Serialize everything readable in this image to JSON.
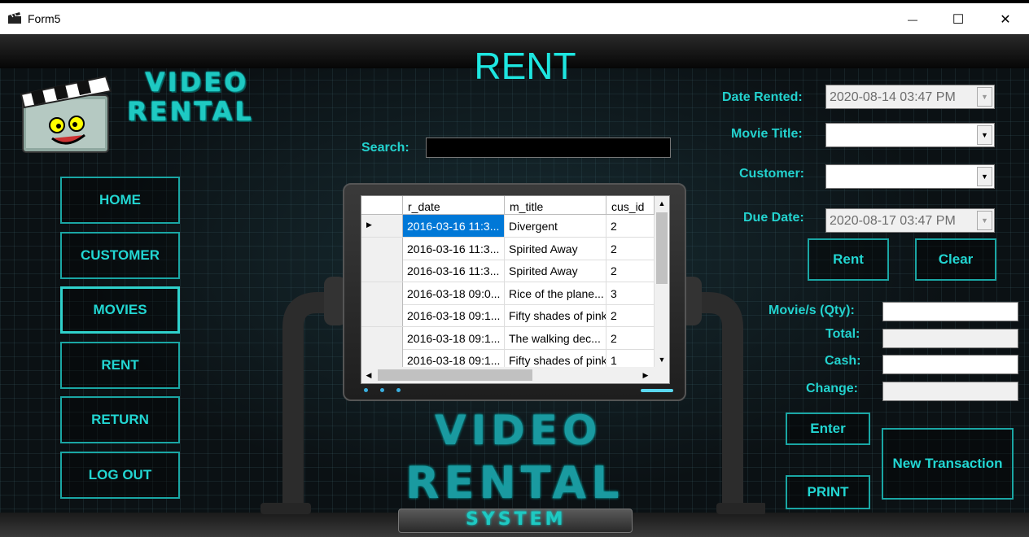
{
  "window": {
    "title": "Form5",
    "minimize_glyph": "—",
    "maximize_glyph": "☐",
    "close_glyph": "✕"
  },
  "logo": {
    "line1": "VIDEO",
    "line2": "RENTAL"
  },
  "page_title": "RENT",
  "nav": {
    "home": "HOME",
    "customer": "CUSTOMER",
    "movies": "MOVIES",
    "rent": "RENT",
    "return": "RETURN",
    "logout": "LOG OUT"
  },
  "search": {
    "label": "Search:",
    "value": ""
  },
  "grid": {
    "columns": [
      "r_date",
      "m_title",
      "cus_id"
    ],
    "rows": [
      {
        "r_date": "2016-03-16 11:3...",
        "m_title": "Divergent",
        "cus_id": "2"
      },
      {
        "r_date": "2016-03-16 11:3...",
        "m_title": "Spirited Away",
        "cus_id": "2"
      },
      {
        "r_date": "2016-03-16 11:3...",
        "m_title": "Spirited Away",
        "cus_id": "2"
      },
      {
        "r_date": "2016-03-18 09:0...",
        "m_title": "Rice of the plane...",
        "cus_id": "3"
      },
      {
        "r_date": "2016-03-18 09:1...",
        "m_title": "Fifty shades of pink",
        "cus_id": "2"
      },
      {
        "r_date": "2016-03-18 09:1...",
        "m_title": "The walking dec...",
        "cus_id": "2"
      },
      {
        "r_date": "2016-03-18 09:1...",
        "m_title": "Fifty shades of pink",
        "cus_id": "1"
      }
    ]
  },
  "form": {
    "date_rented_label": "Date Rented:",
    "date_rented_value": "2020-08-14 03:47 PM",
    "movie_title_label": "Movie Title:",
    "movie_title_value": "",
    "customer_label": "Customer:",
    "customer_value": "",
    "due_date_label": "Due Date:",
    "due_date_value": "2020-08-17 03:47 PM",
    "rent_button": "Rent",
    "clear_button": "Clear",
    "qty_label": "Movie/s (Qty):",
    "total_label": "Total:",
    "cash_label": "Cash:",
    "change_label": "Change:",
    "enter_button": "Enter",
    "print_button": "PRINT",
    "new_transaction_button": "New Transaction"
  },
  "big_logo": {
    "line1": "VIDEO",
    "line2": "RENTAL",
    "line3": "SYSTEM"
  },
  "colors": {
    "accent": "#22d6d2",
    "selection": "#0078d7"
  }
}
